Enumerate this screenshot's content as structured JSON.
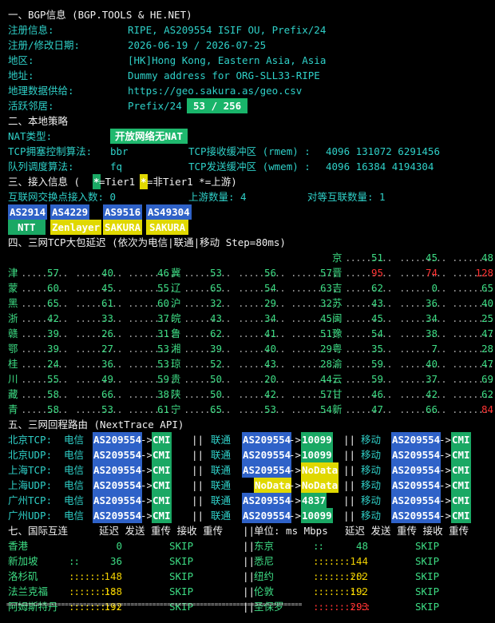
{
  "bgp": {
    "header": "一、BGP信息 (BGP.TOOLS & HE.NET)",
    "rows": [
      {
        "label": "注册信息:",
        "value": "RIPE, AS209554 ISIF OU, Prefix/24"
      },
      {
        "label": "注册/修改日期:",
        "value": "2026-06-19 / 2026-07-25"
      },
      {
        "label": "地区:",
        "value": "[HK]Hong Kong, Eastern Asia, Asia"
      },
      {
        "label": "地址:",
        "value": "Dummy address for ORG-SLL33-RIPE"
      },
      {
        "label": "地理数据供给:",
        "value": "https://geo.sakura.as/geo.csv"
      }
    ],
    "neighbor_label": "活跃邻居:",
    "neighbor_prefix": "Prefix/24",
    "neighbor_count": "53 / 256"
  },
  "local": {
    "header": "二、本地策略",
    "nat_label": "NAT类型:",
    "nat_value": "开放网络无NAT",
    "tcp_cc_label": "TCP拥塞控制算法:",
    "tcp_cc_value": "bbr",
    "rmem_label": "TCP接收缓冲区 (rmem) :",
    "rmem_value": "4096 131072 6291456",
    "qdisc_label": "队列调度算法:",
    "qdisc_value": "fq",
    "wmem_label": "TCP发送缓冲区 (wmem) :",
    "wmem_value": "4096 16384 4194304"
  },
  "access": {
    "header_a": "三、接入信息 (",
    "legend_tier1": "=Tier1 ",
    "legend_nontier1": "=非Tier1 *=上游)",
    "ix_label": "互联网交换点接入数: 0",
    "upstream_label": "上游数量: 4",
    "peer_label": "对等互联数量: 1",
    "as_row": [
      "AS2914",
      "AS4229",
      "AS9516",
      "AS49304"
    ],
    "name_row": [
      "NTT",
      "Zenlayer",
      "SAKURA",
      "SAKURA"
    ]
  },
  "latency": {
    "header": "四、三网TCP大包延迟 (依次为电信|联通|移动 Step=80ms)",
    "rows": [
      [
        [
          "京",
          "51",
          "45",
          "48"
        ]
      ],
      [
        [
          "津",
          "57",
          "40",
          "46"
        ],
        [
          "冀",
          "53",
          "56",
          "57"
        ],
        [
          "晋",
          "95",
          "74",
          "128"
        ]
      ],
      [
        [
          "蒙",
          "60",
          "45",
          "55"
        ],
        [
          "辽",
          "65",
          "54",
          "63"
        ],
        [
          "吉",
          "62",
          "0",
          "65"
        ]
      ],
      [
        [
          "黑",
          "65",
          "61",
          "60"
        ],
        [
          "沪",
          "32",
          "29",
          "32"
        ],
        [
          "苏",
          "43",
          "36",
          "40"
        ]
      ],
      [
        [
          "浙",
          "42",
          "33",
          "37"
        ],
        [
          "皖",
          "43",
          "34",
          "45"
        ],
        [
          "闽",
          "45",
          "34",
          "25"
        ]
      ],
      [
        [
          "赣",
          "39",
          "26",
          "31"
        ],
        [
          "鲁",
          "62",
          "41",
          "51"
        ],
        [
          "豫",
          "54",
          "38",
          "47"
        ]
      ],
      [
        [
          "鄂",
          "39",
          "27",
          "53"
        ],
        [
          "湘",
          "39",
          "40",
          "29"
        ],
        [
          "粤",
          "35",
          "7",
          "28"
        ]
      ],
      [
        [
          "桂",
          "24",
          "36",
          "53"
        ],
        [
          "琼",
          "52",
          "43",
          "28"
        ],
        [
          "渝",
          "59",
          "40",
          "47"
        ]
      ],
      [
        [
          "川",
          "55",
          "49",
          "59"
        ],
        [
          "贵",
          "50",
          "20",
          "44"
        ],
        [
          "云",
          "59",
          "37",
          "69"
        ]
      ],
      [
        [
          "藏",
          "58",
          "66",
          "38"
        ],
        [
          "陕",
          "50",
          "42",
          "57"
        ],
        [
          "甘",
          "46",
          "42",
          "62"
        ]
      ],
      [
        [
          "青",
          "58",
          "53",
          "61"
        ],
        [
          "宁",
          "65",
          "53",
          "54"
        ],
        [
          "新",
          "47",
          "66",
          "84"
        ]
      ]
    ]
  },
  "routes": {
    "header": "五、三网回程路由 (NextTrace API)",
    "rows": [
      {
        "label": "北京TCP:",
        "ct": "电信",
        "ct_as": "AS209554",
        "ct_to": "CMI",
        "cu": "联通",
        "cu_as": "AS209554",
        "cu_to": "10099",
        "cm": "移动",
        "cm_as": "AS209554",
        "cm_to": "CMI"
      },
      {
        "label": "北京UDP:",
        "ct": "电信",
        "ct_as": "AS209554",
        "ct_to": "CMI",
        "cu": "联通",
        "cu_as": "AS209554",
        "cu_to": "10099",
        "cm": "移动",
        "cm_as": "AS209554",
        "cm_to": "CMI"
      },
      {
        "label": "上海TCP:",
        "ct": "电信",
        "ct_as": "AS209554",
        "ct_to": "CMI",
        "cu": "联通",
        "cu_as": "AS209554",
        "cu_to": "NoData",
        "cm": "移动",
        "cm_as": "AS209554",
        "cm_to": "CMI"
      },
      {
        "label": "上海UDP:",
        "ct": "电信",
        "ct_as": "AS209554",
        "ct_to": "CMI",
        "cu": "联通",
        "cu_as": "NoData",
        "cu_to": "NoData",
        "cm": "移动",
        "cm_as": "AS209554",
        "cm_to": "CMI"
      },
      {
        "label": "广州TCP:",
        "ct": "电信",
        "ct_as": "AS209554",
        "ct_to": "CMI",
        "cu": "联通",
        "cu_as": "AS209554",
        "cu_to": "4837",
        "cm": "移动",
        "cm_as": "AS209554",
        "cm_to": "CMI"
      },
      {
        "label": "广州UDP:",
        "ct": "电信",
        "ct_as": "AS209554",
        "ct_to": "CMI",
        "cu": "联通",
        "cu_as": "AS209554",
        "cu_to": "10099",
        "cm": "移动",
        "cm_as": "AS209554",
        "cm_to": "CMI"
      }
    ]
  },
  "intl": {
    "header": "七、国际互连",
    "cols": "延迟 发送 重传 接收 重传",
    "unit": "单位: ms Mbps",
    "cols2": "延迟 发送 重传 接收 重传",
    "left": [
      {
        "city": "香港",
        "lat": "0",
        "send": "SKIP"
      },
      {
        "city": "新加坡",
        "lat": "36",
        "send": "SKIP"
      },
      {
        "city": "洛杉矶",
        "lat": "148",
        "send": "SKIP"
      },
      {
        "city": "法兰克福",
        "lat": "188",
        "send": "SKIP"
      },
      {
        "city": "阿姆斯特丹",
        "lat": "192",
        "send": "SKIP"
      }
    ],
    "right": [
      {
        "city": "东京",
        "lat": "48",
        "send": "SKIP"
      },
      {
        "city": "悉尼",
        "lat": "144",
        "send": "SKIP"
      },
      {
        "city": "纽约",
        "lat": "202",
        "send": "SKIP"
      },
      {
        "city": "伦敦",
        "lat": "192",
        "send": "SKIP"
      },
      {
        "city": "圣保罗",
        "lat": "293",
        "send": "SKIP"
      }
    ]
  },
  "footer_rule": "================================================================================="
}
